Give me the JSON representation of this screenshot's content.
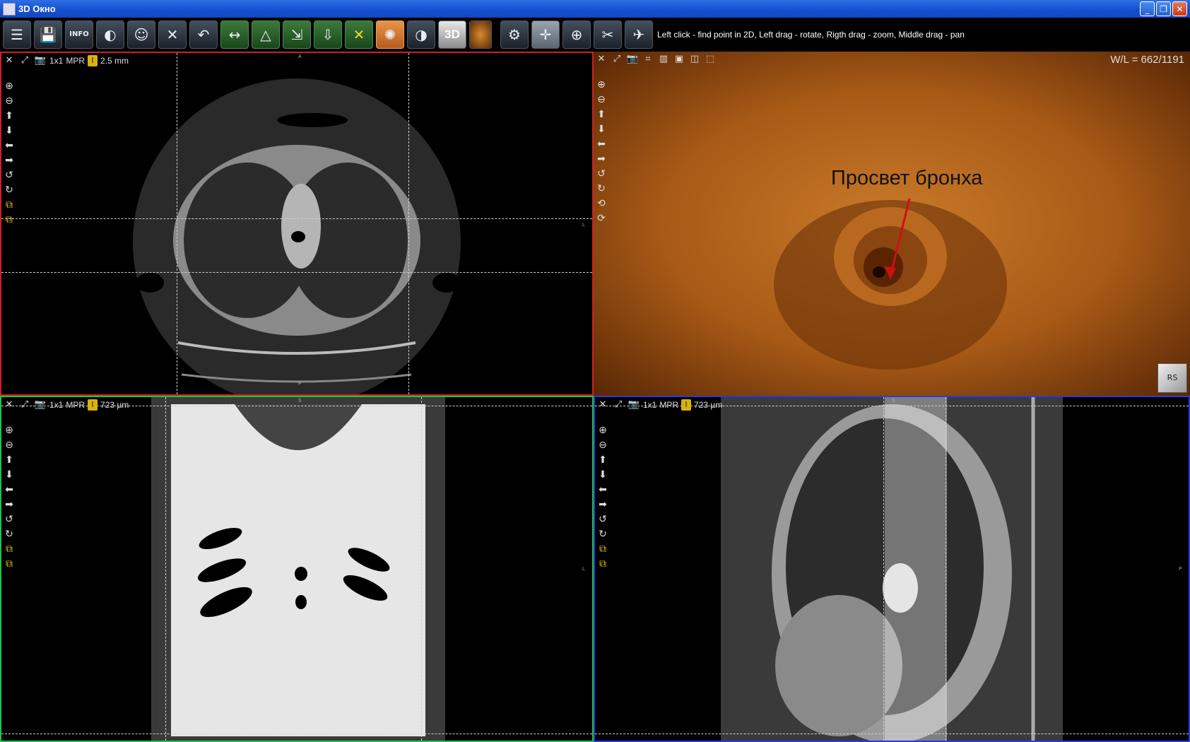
{
  "window": {
    "title": "3D Окно"
  },
  "toolbar": {
    "hint": "Left click - find point in 2D, Left drag - rotate, Rigth drag - zoom, Middle drag - pan",
    "buttons": [
      {
        "name": "layout-icon",
        "glyph": "☰"
      },
      {
        "name": "save-icon",
        "glyph": "💾"
      },
      {
        "name": "info-icon",
        "glyph": "INFO"
      },
      {
        "name": "contrast-settings-icon",
        "glyph": "◐"
      },
      {
        "name": "head-icon",
        "glyph": "☺"
      },
      {
        "name": "tools-icon",
        "glyph": "✕"
      },
      {
        "name": "undo-icon",
        "glyph": "↶"
      },
      {
        "name": "ruler-icon",
        "glyph": "↔"
      },
      {
        "name": "angle-icon",
        "glyph": "△"
      },
      {
        "name": "export-icon",
        "glyph": "⇲"
      },
      {
        "name": "import-icon",
        "glyph": "⇩"
      },
      {
        "name": "delete-icon",
        "glyph": "✕"
      },
      {
        "name": "volume-render-icon",
        "glyph": "✺"
      },
      {
        "name": "invert-icon",
        "glyph": "◑"
      },
      {
        "name": "3d-icon",
        "glyph": "3D"
      },
      {
        "name": "texture-icon",
        "glyph": ""
      },
      {
        "name": "settings-head-icon",
        "glyph": "⚙"
      },
      {
        "name": "crosshair-icon",
        "glyph": "✛"
      },
      {
        "name": "magnifier-icon",
        "glyph": "⊕"
      },
      {
        "name": "scissors-icon",
        "glyph": "✂"
      },
      {
        "name": "airplane-icon",
        "glyph": "✈"
      }
    ]
  },
  "viewports": {
    "axial": {
      "layout": "1x1",
      "mode": "MPR",
      "thickness": "2.5 mm",
      "marker_top": "A",
      "marker_bottom": "P",
      "marker_right": "L"
    },
    "volume": {
      "wl": "W/L = 662/1191",
      "annotation": "Просвет бронха",
      "cube": "RS"
    },
    "coronal": {
      "layout": "1x1",
      "mode": "MPR",
      "thickness": "723 µm",
      "marker_top": "S",
      "marker_right": "L"
    },
    "sagittal": {
      "layout": "1x1",
      "mode": "MPR",
      "thickness": "723 µm",
      "marker_top": "S",
      "marker_right": "P"
    }
  }
}
